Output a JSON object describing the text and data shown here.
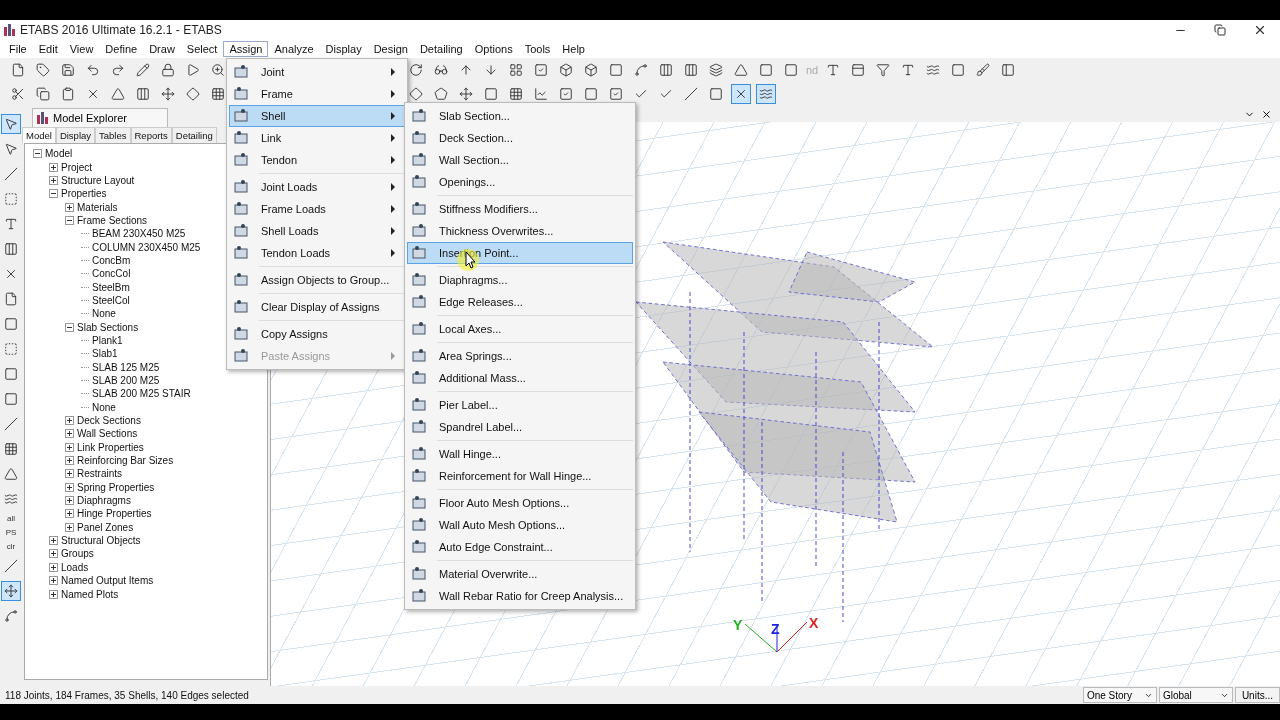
{
  "window": {
    "title": "ETABS 2016 Ultimate 16.2.1 - ETABS"
  },
  "menu_bar": [
    {
      "label": "File",
      "selected": false
    },
    {
      "label": "Edit",
      "selected": false
    },
    {
      "label": "View",
      "selected": false
    },
    {
      "label": "Define",
      "selected": false
    },
    {
      "label": "Draw",
      "selected": false
    },
    {
      "label": "Select",
      "selected": false
    },
    {
      "label": "Assign",
      "selected": true
    },
    {
      "label": "Analyze",
      "selected": false
    },
    {
      "label": "Display",
      "selected": false
    },
    {
      "label": "Design",
      "selected": false
    },
    {
      "label": "Detailing",
      "selected": false
    },
    {
      "label": "Options",
      "selected": false
    },
    {
      "label": "Tools",
      "selected": false
    },
    {
      "label": "Help",
      "selected": false
    }
  ],
  "toolbar": {
    "disabled_text": "nd",
    "toggles": [
      {
        "pressed": true
      },
      {
        "pressed": true
      }
    ]
  },
  "side_tools": {
    "texts": [
      "all",
      "PS",
      "clr"
    ],
    "toggles": [
      {
        "pressed": true
      },
      {
        "pressed": false
      },
      {
        "pressed": true
      }
    ]
  },
  "explorer": {
    "title": "Model Explorer",
    "tabs": [
      {
        "label": "Model",
        "selected": true
      },
      {
        "label": "Display",
        "selected": false
      },
      {
        "label": "Tables",
        "selected": false
      },
      {
        "label": "Reports",
        "selected": false
      },
      {
        "label": "Detailing",
        "selected": false
      }
    ],
    "tree": [
      {
        "label": "Model",
        "expanded": true,
        "children": [
          {
            "label": "Project",
            "expanded": false
          },
          {
            "label": "Structure Layout",
            "expanded": false
          },
          {
            "label": "Properties",
            "expanded": true,
            "children": [
              {
                "label": "Materials",
                "expanded": false
              },
              {
                "label": "Frame Sections",
                "expanded": true,
                "children": [
                  {
                    "label": "BEAM 230X450 M25"
                  },
                  {
                    "label": "COLUMN 230X450 M25"
                  },
                  {
                    "label": "ConcBm"
                  },
                  {
                    "label": "ConcCol"
                  },
                  {
                    "label": "SteelBm"
                  },
                  {
                    "label": "SteelCol"
                  },
                  {
                    "label": "None"
                  }
                ]
              },
              {
                "label": "Slab Sections",
                "expanded": true,
                "children": [
                  {
                    "label": "Plank1"
                  },
                  {
                    "label": "Slab1"
                  },
                  {
                    "label": "SLAB 125 M25"
                  },
                  {
                    "label": "SLAB 200 M25"
                  },
                  {
                    "label": "SLAB 200 M25 STAIR"
                  },
                  {
                    "label": "None"
                  }
                ]
              },
              {
                "label": "Deck Sections",
                "expanded": false
              },
              {
                "label": "Wall Sections",
                "expanded": false
              },
              {
                "label": "Link Properties",
                "expanded": false
              },
              {
                "label": "Reinforcing Bar Sizes",
                "expanded": false
              },
              {
                "label": "Restraints",
                "expanded": false
              },
              {
                "label": "Spring Properties",
                "expanded": false
              },
              {
                "label": "Diaphragms",
                "expanded": false
              },
              {
                "label": "Hinge Properties",
                "expanded": false
              },
              {
                "label": "Panel Zones",
                "expanded": false
              }
            ]
          },
          {
            "label": "Structural Objects",
            "expanded": false
          },
          {
            "label": "Groups",
            "expanded": false
          },
          {
            "label": "Loads",
            "expanded": false
          },
          {
            "label": "Named Output Items",
            "expanded": false
          },
          {
            "label": "Named Plots",
            "expanded": false
          }
        ]
      }
    ]
  },
  "viewport": {
    "axes": [
      {
        "label": "Y",
        "color": "#20b020"
      },
      {
        "label": "Z",
        "color": "#2020e0"
      },
      {
        "label": "X",
        "color": "#e02020"
      }
    ]
  },
  "assign_menu": [
    {
      "kind": "item",
      "label": "Joint",
      "submenu": true,
      "selected": false,
      "disabled": false
    },
    {
      "kind": "item",
      "label": "Frame",
      "submenu": true,
      "selected": false,
      "disabled": false
    },
    {
      "kind": "item",
      "label": "Shell",
      "submenu": true,
      "selected": true,
      "disabled": false
    },
    {
      "kind": "item",
      "label": "Link",
      "submenu": true,
      "selected": false,
      "disabled": false
    },
    {
      "kind": "item",
      "label": "Tendon",
      "submenu": true,
      "selected": false,
      "disabled": false
    },
    {
      "kind": "separator"
    },
    {
      "kind": "item",
      "label": "Joint Loads",
      "submenu": true,
      "selected": false,
      "disabled": false
    },
    {
      "kind": "item",
      "label": "Frame Loads",
      "submenu": true,
      "selected": false,
      "disabled": false
    },
    {
      "kind": "item",
      "label": "Shell Loads",
      "submenu": true,
      "selected": false,
      "disabled": false
    },
    {
      "kind": "item",
      "label": "Tendon Loads",
      "submenu": true,
      "selected": false,
      "disabled": false
    },
    {
      "kind": "separator"
    },
    {
      "kind": "item",
      "label": "Assign Objects to Group...",
      "submenu": false,
      "selected": false,
      "disabled": false
    },
    {
      "kind": "separator"
    },
    {
      "kind": "item",
      "label": "Clear Display of Assigns",
      "submenu": false,
      "selected": false,
      "disabled": false
    },
    {
      "kind": "separator"
    },
    {
      "kind": "item",
      "label": "Copy Assigns",
      "submenu": false,
      "selected": false,
      "disabled": false
    },
    {
      "kind": "item",
      "label": "Paste Assigns",
      "submenu": true,
      "selected": false,
      "disabled": true
    }
  ],
  "shell_submenu": [
    {
      "kind": "item",
      "label": "Slab Section...",
      "selected": false
    },
    {
      "kind": "item",
      "label": "Deck Section...",
      "selected": false
    },
    {
      "kind": "item",
      "label": "Wall Section...",
      "selected": false
    },
    {
      "kind": "item",
      "label": "Openings...",
      "selected": false
    },
    {
      "kind": "separator"
    },
    {
      "kind": "item",
      "label": "Stiffness Modifiers...",
      "selected": false
    },
    {
      "kind": "item",
      "label": "Thickness Overwrites...",
      "selected": false
    },
    {
      "kind": "item",
      "label": "Insertion Point...",
      "selected": true
    },
    {
      "kind": "separator"
    },
    {
      "kind": "item",
      "label": "Diaphragms...",
      "selected": false
    },
    {
      "kind": "item",
      "label": "Edge Releases...",
      "selected": false
    },
    {
      "kind": "separator"
    },
    {
      "kind": "item",
      "label": "Local Axes...",
      "selected": false
    },
    {
      "kind": "separator"
    },
    {
      "kind": "item",
      "label": "Area Springs...",
      "selected": false
    },
    {
      "kind": "item",
      "label": "Additional Mass...",
      "selected": false
    },
    {
      "kind": "separator"
    },
    {
      "kind": "item",
      "label": "Pier Label...",
      "selected": false
    },
    {
      "kind": "item",
      "label": "Spandrel Label...",
      "selected": false
    },
    {
      "kind": "separator"
    },
    {
      "kind": "item",
      "label": "Wall Hinge...",
      "selected": false
    },
    {
      "kind": "item",
      "label": "Reinforcement for Wall Hinge...",
      "selected": false
    },
    {
      "kind": "separator"
    },
    {
      "kind": "item",
      "label": "Floor Auto Mesh Options...",
      "selected": false
    },
    {
      "kind": "item",
      "label": "Wall Auto Mesh Options...",
      "selected": false
    },
    {
      "kind": "item",
      "label": "Auto Edge Constraint...",
      "selected": false
    },
    {
      "kind": "separator"
    },
    {
      "kind": "item",
      "label": "Material Overwrite...",
      "selected": false
    },
    {
      "kind": "item",
      "label": "Wall Rebar Ratio for Creep Analysis...",
      "selected": false
    }
  ],
  "status_bar": {
    "text": "118 Joints, 184 Frames, 35 Shells, 140 Edges selected",
    "story": "One Story",
    "coord_system": "Global",
    "units_button": "Units..."
  }
}
